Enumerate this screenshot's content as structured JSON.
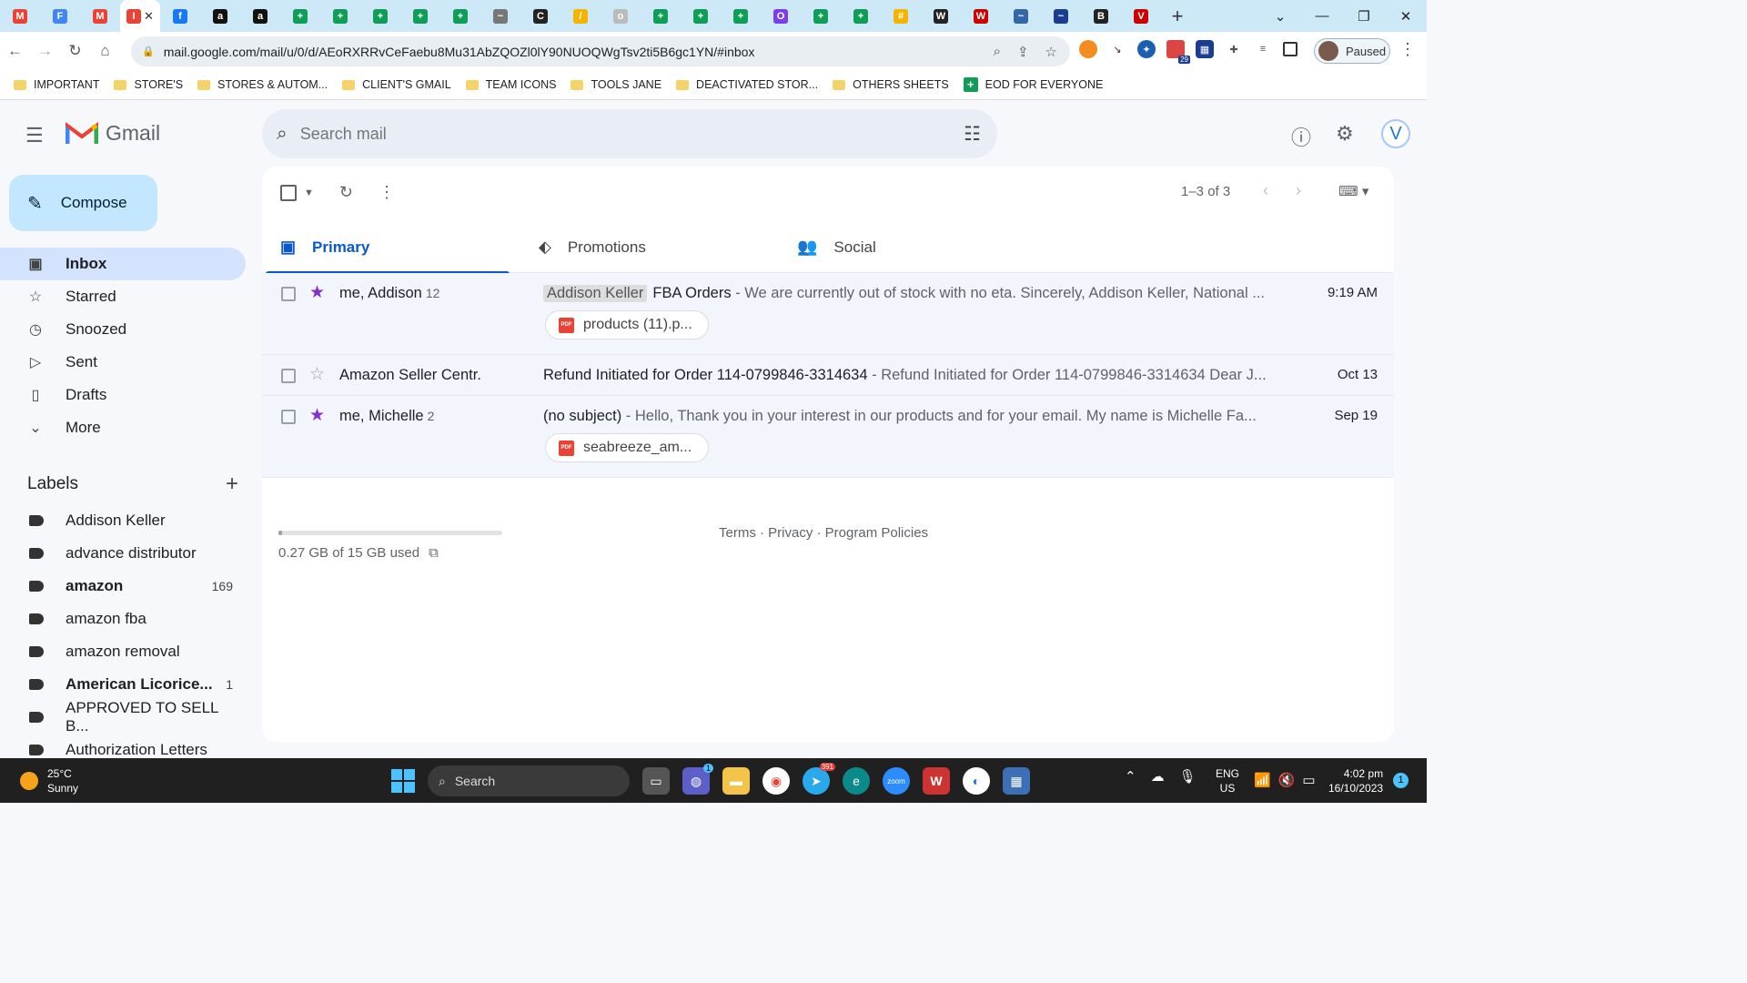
{
  "browser": {
    "tabs": [
      {
        "label": "M",
        "color": "#ea4335"
      },
      {
        "label": "F",
        "color": "#4285f4"
      },
      {
        "label": "M",
        "color": "#ea4335"
      },
      {
        "label": "I",
        "color": "#ea4335",
        "active": true
      },
      {
        "label": "f",
        "color": "#1877f2"
      },
      {
        "label": "a",
        "color": "#111"
      },
      {
        "label": "a",
        "color": "#111"
      },
      {
        "label": "+",
        "color": "#0f9d58"
      },
      {
        "label": "+",
        "color": "#0f9d58"
      },
      {
        "label": "+",
        "color": "#0f9d58"
      },
      {
        "label": "+",
        "color": "#0f9d58"
      },
      {
        "label": "+",
        "color": "#0f9d58"
      },
      {
        "label": "~",
        "color": "#777"
      },
      {
        "label": "C",
        "color": "#222"
      },
      {
        "label": "/",
        "color": "#f4b400"
      },
      {
        "label": "o",
        "color": "#bbb"
      },
      {
        "label": "+",
        "color": "#0f9d58"
      },
      {
        "label": "+",
        "color": "#0f9d58"
      },
      {
        "label": "+",
        "color": "#0f9d58"
      },
      {
        "label": "O",
        "color": "#7b3fe4"
      },
      {
        "label": "+",
        "color": "#0f9d58"
      },
      {
        "label": "+",
        "color": "#0f9d58"
      },
      {
        "label": "#",
        "color": "#f4b400"
      },
      {
        "label": "W",
        "color": "#222"
      },
      {
        "label": "W",
        "color": "#c00"
      },
      {
        "label": "~",
        "color": "#3466a8"
      },
      {
        "label": "~",
        "color": "#1a3d8f"
      },
      {
        "label": "B",
        "color": "#222"
      },
      {
        "label": "V",
        "color": "#c00"
      }
    ],
    "url": "mail.google.com/mail/u/0/d/AEoRXRRvCeFaebu8Mu31AbZQOZl0lY90NUOQWgTsv2ti5B6gc1YN/#inbox",
    "profile_status": "Paused",
    "ext_badge": "29",
    "bookmarks": [
      {
        "label": "IMPORTANT",
        "type": "folder"
      },
      {
        "label": "STORE'S",
        "type": "folder"
      },
      {
        "label": "STORES & AUTOM...",
        "type": "folder"
      },
      {
        "label": "CLIENT'S GMAIL",
        "type": "folder"
      },
      {
        "label": "TEAM ICONS",
        "type": "folder"
      },
      {
        "label": "TOOLS JANE",
        "type": "folder"
      },
      {
        "label": "DEACTIVATED STOR...",
        "type": "folder"
      },
      {
        "label": "OTHERS SHEETS",
        "type": "folder"
      },
      {
        "label": "EOD FOR EVERYONE",
        "type": "sheet"
      }
    ]
  },
  "gmail": {
    "logo_text": "Gmail",
    "search_placeholder": "Search mail",
    "avatar_letter": "V",
    "compose": "Compose",
    "nav": [
      {
        "label": "Inbox",
        "icon": "inbox-icon",
        "glyph": "▣",
        "selected": true
      },
      {
        "label": "Starred",
        "icon": "star-icon",
        "glyph": "☆"
      },
      {
        "label": "Snoozed",
        "icon": "clock-icon",
        "glyph": "◷"
      },
      {
        "label": "Sent",
        "icon": "send-icon",
        "glyph": "▷"
      },
      {
        "label": "Drafts",
        "icon": "draft-icon",
        "glyph": "▯"
      },
      {
        "label": "More",
        "icon": "chevron-down-icon",
        "glyph": "⌄"
      }
    ],
    "labels_title": "Labels",
    "labels": [
      {
        "label": "Addison Keller"
      },
      {
        "label": "advance distributor"
      },
      {
        "label": "amazon",
        "count": "169",
        "bold": true
      },
      {
        "label": "amazon fba"
      },
      {
        "label": "amazon removal"
      },
      {
        "label": "American Licorice...",
        "count": "1",
        "bold": true
      },
      {
        "label": "APPROVED TO SELL B..."
      },
      {
        "label": "Authorization Letters"
      }
    ],
    "pager": "1–3 of 3",
    "category_tabs": [
      {
        "label": "Primary",
        "icon": "inbox-icon",
        "glyph": "▣",
        "selected": true
      },
      {
        "label": "Promotions",
        "icon": "tag-icon",
        "glyph": "⬖"
      },
      {
        "label": "Social",
        "icon": "people-icon",
        "glyph": "👥"
      }
    ],
    "emails": [
      {
        "sender": "me, Addison",
        "count": "12",
        "label": "Addison Keller",
        "subject": "FBA Orders",
        "snippet": " - We are currently out of stock with no eta. Sincerely, Addison Keller, National ...",
        "date": "9:19 AM",
        "starred": true,
        "attachment": "products (11).p..."
      },
      {
        "sender": "Amazon Seller Centr.",
        "count": "",
        "label": "",
        "subject": "Refund Initiated for Order 114-0799846-3314634",
        "snippet": " - Refund Initiated for Order 114-0799846-3314634 Dear J...",
        "date": "Oct 13",
        "starred": false,
        "attachment": ""
      },
      {
        "sender": "me, Michelle",
        "count": "2",
        "label": "",
        "subject": "(no subject)",
        "snippet": " - Hello, Thank you in your interest in our products and for your email. My name is Michelle Fa...",
        "date": "Sep 19",
        "starred": true,
        "attachment": "seabreeze_am..."
      }
    ],
    "storage_text": "0.27 GB of 15 GB used",
    "storage_fraction": 0.018,
    "footer": "Terms · Privacy · Program Policies"
  },
  "taskbar": {
    "temp": "25°C",
    "condition": "Sunny",
    "search": "Search",
    "lang1": "ENG",
    "lang2": "US",
    "time": "4:02 pm",
    "date": "16/10/2023",
    "notif_count": "1",
    "teams_badge": "1",
    "telegram_badge": "391"
  },
  "colors": {
    "accent": "#0b57d0",
    "compose_bg": "#c2e7ff",
    "selected_nav": "#d3e3fd",
    "star": "#8430ce"
  }
}
